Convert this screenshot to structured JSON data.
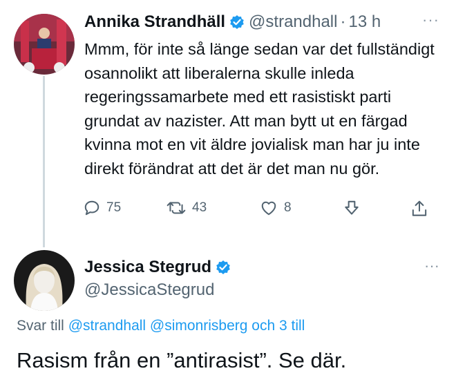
{
  "tweet1": {
    "author_name": "Annika Strandhäll",
    "handle": "@strandhall",
    "separator": "·",
    "time": "13 h",
    "more": "···",
    "text": "Mmm, för inte så länge sedan var det fullständigt osannolikt att liberalerna skulle inleda regeringssamarbete med ett rasistiskt parti grundat av nazister. Att man bytt ut en färgad kvinna mot en vit äldre jovialisk man har ju inte direkt förändrat att det är det man nu gör.",
    "replies": "75",
    "retweets": "43",
    "likes": "8"
  },
  "tweet2": {
    "author_name": "Jessica Stegrud",
    "handle": "@JessicaStegrud",
    "more": "···",
    "reply_prefix": "Svar till",
    "reply_mention_1": "@strandhall",
    "reply_mention_2": "@simonrisberg",
    "reply_suffix": "och 3 till",
    "text": "Rasism från en ”antirasist”. Se där."
  },
  "colors": {
    "verified": "#1d9bf0",
    "link": "#1d9bf0",
    "muted": "#536471",
    "thread_line": "#cfd9de"
  },
  "icons": [
    "verified-badge-icon",
    "reply-icon",
    "retweet-icon",
    "like-icon",
    "download-icon",
    "share-icon"
  ]
}
